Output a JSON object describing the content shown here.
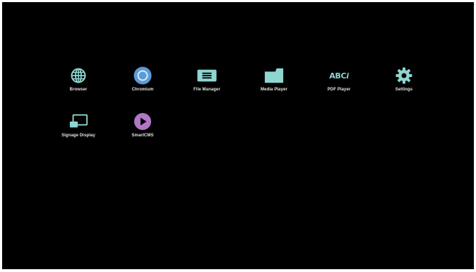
{
  "colors": {
    "background": "#000000",
    "icon_teal": "#8fd5d0",
    "chromium_blue": "#5b9bd5",
    "smartcms_purple": "#b077c4",
    "label": "#e6e6e6"
  },
  "apps": [
    {
      "label": "Browser",
      "icon": "globe-icon"
    },
    {
      "label": "Chromium",
      "icon": "chromium-icon"
    },
    {
      "label": "File Manager",
      "icon": "file-manager-icon"
    },
    {
      "label": "Media Player",
      "icon": "folder-icon"
    },
    {
      "label": "PDF Player",
      "icon": "abc-icon",
      "icon_text": "ABC",
      "icon_text_italic": "i"
    },
    {
      "label": "Settings",
      "icon": "gear-icon"
    },
    {
      "label": "Signage Display",
      "icon": "cast-display-icon"
    },
    {
      "label": "SmartCMS",
      "icon": "play-circle-icon"
    }
  ]
}
